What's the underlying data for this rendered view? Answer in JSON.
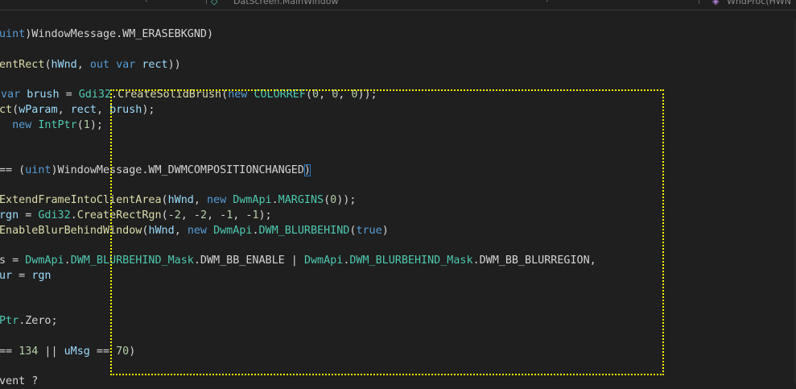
{
  "topbar": {
    "left_fragment": "·",
    "center_crumb": "DatScreen.MainWindow",
    "right_fragment": "·",
    "method_crumb": "WndProc(HWN"
  },
  "code_lines": [
    {
      "tokens": [
        {
          "t": "uint",
          "c": "kw"
        },
        {
          "t": ")WindowMessage.WM_ERASEBKGND)",
          "c": "txt"
        }
      ]
    },
    {
      "tokens": []
    },
    {
      "tokens": [
        {
          "t": "entRect",
          "c": "fn"
        },
        {
          "t": "(",
          "c": "txt"
        },
        {
          "t": "hWnd",
          "c": "var"
        },
        {
          "t": ", ",
          "c": "txt"
        },
        {
          "t": "out",
          "c": "kw"
        },
        {
          "t": " ",
          "c": "txt"
        },
        {
          "t": "var",
          "c": "kw"
        },
        {
          "t": " ",
          "c": "txt"
        },
        {
          "t": "rect",
          "c": "var"
        },
        {
          "t": "))",
          "c": "txt"
        }
      ]
    },
    {
      "tokens": []
    },
    {
      "tokens": [
        {
          "t": "var",
          "c": "kw"
        },
        {
          "t": " ",
          "c": "txt"
        },
        {
          "t": "brush",
          "c": "var"
        },
        {
          "t": " = ",
          "c": "txt"
        },
        {
          "t": "Gdi32",
          "c": "type"
        },
        {
          "t": ".",
          "c": "txt"
        },
        {
          "t": "CreateSolidBrush",
          "c": "fn"
        },
        {
          "t": "(",
          "c": "txt"
        },
        {
          "t": "new",
          "c": "kw"
        },
        {
          "t": " ",
          "c": "txt"
        },
        {
          "t": "COLORREF",
          "c": "type"
        },
        {
          "t": "(",
          "c": "txt"
        },
        {
          "t": "0",
          "c": "num"
        },
        {
          "t": ", ",
          "c": "txt"
        },
        {
          "t": "0",
          "c": "num"
        },
        {
          "t": ", ",
          "c": "txt"
        },
        {
          "t": "0",
          "c": "num"
        },
        {
          "t": "));",
          "c": "txt"
        }
      ]
    },
    {
      "tokens": [
        {
          "t": "ct",
          "c": "fn"
        },
        {
          "t": "(",
          "c": "txt"
        },
        {
          "t": "wParam",
          "c": "var"
        },
        {
          "t": ", ",
          "c": "txt"
        },
        {
          "t": "rect",
          "c": "var"
        },
        {
          "t": ", ",
          "c": "txt"
        },
        {
          "t": "brush",
          "c": "var"
        },
        {
          "t": ");",
          "c": "txt"
        }
      ]
    },
    {
      "tokens": [
        {
          "t": " ",
          "c": "txt"
        },
        {
          "t": "new",
          "c": "kw"
        },
        {
          "t": " ",
          "c": "txt"
        },
        {
          "t": "IntPtr",
          "c": "type"
        },
        {
          "t": "(",
          "c": "txt"
        },
        {
          "t": "1",
          "c": "num"
        },
        {
          "t": ");",
          "c": "txt"
        }
      ]
    },
    {
      "tokens": []
    },
    {
      "tokens": []
    },
    {
      "tokens": [
        {
          "t": "== (",
          "c": "txt"
        },
        {
          "t": "uint",
          "c": "kw"
        },
        {
          "t": ")WindowMessage.WM_DWMCOMPOSITIONCHANGED",
          "c": "txt"
        },
        {
          "t": ")",
          "c": "bm"
        }
      ]
    },
    {
      "tokens": []
    },
    {
      "tokens": [
        {
          "t": "ExtendFrameIntoClientArea",
          "c": "fn"
        },
        {
          "t": "(",
          "c": "txt"
        },
        {
          "t": "hWnd",
          "c": "var"
        },
        {
          "t": ", ",
          "c": "txt"
        },
        {
          "t": "new",
          "c": "kw"
        },
        {
          "t": " ",
          "c": "txt"
        },
        {
          "t": "DwmApi",
          "c": "type"
        },
        {
          "t": ".",
          "c": "txt"
        },
        {
          "t": "MARGINS",
          "c": "type"
        },
        {
          "t": "(",
          "c": "txt"
        },
        {
          "t": "0",
          "c": "num"
        },
        {
          "t": "));",
          "c": "txt"
        }
      ]
    },
    {
      "tokens": [
        {
          "t": "rgn",
          "c": "var"
        },
        {
          "t": " = ",
          "c": "txt"
        },
        {
          "t": "Gdi32",
          "c": "type"
        },
        {
          "t": ".",
          "c": "txt"
        },
        {
          "t": "CreateRectRgn",
          "c": "fn"
        },
        {
          "t": "(-",
          "c": "txt"
        },
        {
          "t": "2",
          "c": "num"
        },
        {
          "t": ", -",
          "c": "txt"
        },
        {
          "t": "2",
          "c": "num"
        },
        {
          "t": ", -",
          "c": "txt"
        },
        {
          "t": "1",
          "c": "num"
        },
        {
          "t": ", -",
          "c": "txt"
        },
        {
          "t": "1",
          "c": "num"
        },
        {
          "t": ");",
          "c": "txt"
        }
      ]
    },
    {
      "tokens": [
        {
          "t": "EnableBlurBehindWindow",
          "c": "fn"
        },
        {
          "t": "(",
          "c": "txt"
        },
        {
          "t": "hWnd",
          "c": "var"
        },
        {
          "t": ", ",
          "c": "txt"
        },
        {
          "t": "new",
          "c": "kw"
        },
        {
          "t": " ",
          "c": "txt"
        },
        {
          "t": "DwmApi",
          "c": "type"
        },
        {
          "t": ".",
          "c": "txt"
        },
        {
          "t": "DWM_BLURBEHIND",
          "c": "type"
        },
        {
          "t": "(",
          "c": "txt"
        },
        {
          "t": "true",
          "c": "kw"
        },
        {
          "t": ")",
          "c": "txt"
        }
      ]
    },
    {
      "tokens": []
    },
    {
      "tokens": [
        {
          "t": "s = ",
          "c": "txt"
        },
        {
          "t": "DwmApi",
          "c": "type"
        },
        {
          "t": ".",
          "c": "txt"
        },
        {
          "t": "DWM_BLURBEHIND_Mask",
          "c": "type"
        },
        {
          "t": ".DWM_BB_ENABLE | ",
          "c": "txt"
        },
        {
          "t": "DwmApi",
          "c": "type"
        },
        {
          "t": ".",
          "c": "txt"
        },
        {
          "t": "DWM_BLURBEHIND_Mask",
          "c": "type"
        },
        {
          "t": ".DWM_BB_BLURREGION,",
          "c": "txt"
        }
      ]
    },
    {
      "tokens": [
        {
          "t": "ur",
          "c": "var"
        },
        {
          "t": " = ",
          "c": "txt"
        },
        {
          "t": "rgn",
          "c": "var"
        }
      ]
    },
    {
      "tokens": []
    },
    {
      "tokens": []
    },
    {
      "tokens": [
        {
          "t": "Ptr",
          "c": "type"
        },
        {
          "t": ".Zero;",
          "c": "txt"
        }
      ]
    },
    {
      "tokens": []
    },
    {
      "tokens": [
        {
          "t": "== ",
          "c": "txt"
        },
        {
          "t": "134",
          "c": "num"
        },
        {
          "t": " || ",
          "c": "txt"
        },
        {
          "t": "uMsg",
          "c": "var"
        },
        {
          "t": " == ",
          "c": "txt"
        },
        {
          "t": "70",
          "c": "num"
        },
        {
          "t": ")",
          "c": "txt"
        }
      ]
    },
    {
      "tokens": []
    },
    {
      "tokens": [
        {
          "t": "vent ?",
          "c": "txt"
        }
      ]
    }
  ],
  "colors": {
    "background": "#1f1f1f",
    "keyword": "#569cd6",
    "type": "#4ec9b0",
    "function": "#dcdcaa",
    "variable": "#9cdcfe",
    "number": "#b5cea8",
    "plain": "#d4d4d4",
    "annotation_box": "#ffff00"
  }
}
